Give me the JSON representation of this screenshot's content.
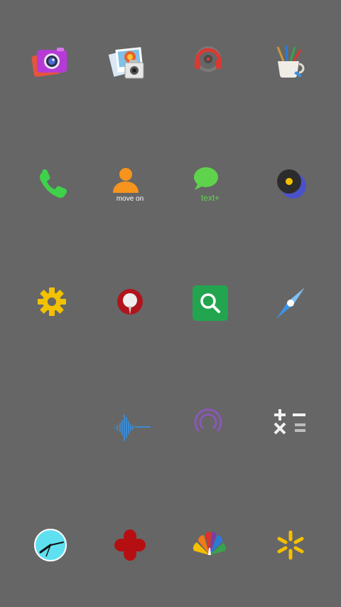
{
  "screen": {
    "background": "#666666",
    "apps": [
      {
        "icon": "camera-icon",
        "accent": "#b63bd6"
      },
      {
        "icon": "photo-gallery-icon",
        "accent": "#e9602a"
      },
      {
        "icon": "headphones-icon",
        "accent": "#d83a33"
      },
      {
        "icon": "paint-brushes-cup-icon",
        "accent": "#7a6a55"
      },
      {
        "icon": "phone-icon",
        "accent": "#3fd14a"
      },
      {
        "icon": "contacts-move-on-icon",
        "accent": "#f7941d",
        "caption": "move on"
      },
      {
        "icon": "messages-text-plus-icon",
        "accent": "#5fd34c",
        "caption": "text+"
      },
      {
        "icon": "music-disc-icon",
        "accent": "#4a52c9"
      },
      {
        "icon": "settings-gear-icon",
        "accent": "#f2c100"
      },
      {
        "icon": "map-pin-icon",
        "accent": "#b0141c"
      },
      {
        "icon": "search-icon",
        "accent": "#23a54f"
      },
      {
        "icon": "compass-icon",
        "accent": "#3a95e8"
      },
      {
        "icon": "blank-app-icon",
        "accent": "#666666"
      },
      {
        "icon": "sound-wave-icon",
        "accent": "#3d8ad0"
      },
      {
        "icon": "podcast-signal-icon",
        "accent": "#8a58b8"
      },
      {
        "icon": "calculator-icon",
        "accent": "#f2f2f2"
      },
      {
        "icon": "clock-icon",
        "accent": "#5fe0f0"
      },
      {
        "icon": "red-flower-icon",
        "accent": "#b50f12"
      },
      {
        "icon": "peacock-icon",
        "accent": "#f5a623"
      },
      {
        "icon": "sunburst-icon",
        "accent": "#f5c000"
      }
    ]
  }
}
